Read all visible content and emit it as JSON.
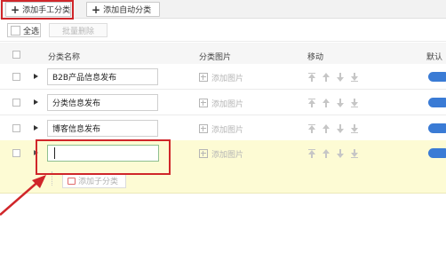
{
  "toolbar": {
    "add_manual_label": "添加手工分类",
    "add_auto_label": "添加自动分类"
  },
  "actions": {
    "select_all_label": "全选",
    "bulk_delete_label": "批量删除"
  },
  "columns": {
    "name": "分类名称",
    "image": "分类图片",
    "move": "移动",
    "default": "默认"
  },
  "rows": [
    {
      "name": "B2B产品信息发布",
      "image_label": "添加图片"
    },
    {
      "name": "分类信息发布",
      "image_label": "添加图片"
    },
    {
      "name": "博客信息发布",
      "image_label": "添加图片"
    }
  ],
  "new_row": {
    "input_value": "",
    "image_label": "添加图片",
    "add_sub_label": "添加子分类"
  },
  "colors": {
    "highlight_row": "#fdfbd4",
    "annotation_red": "#d0262a",
    "toggle_blue": "#3a7bd5"
  }
}
